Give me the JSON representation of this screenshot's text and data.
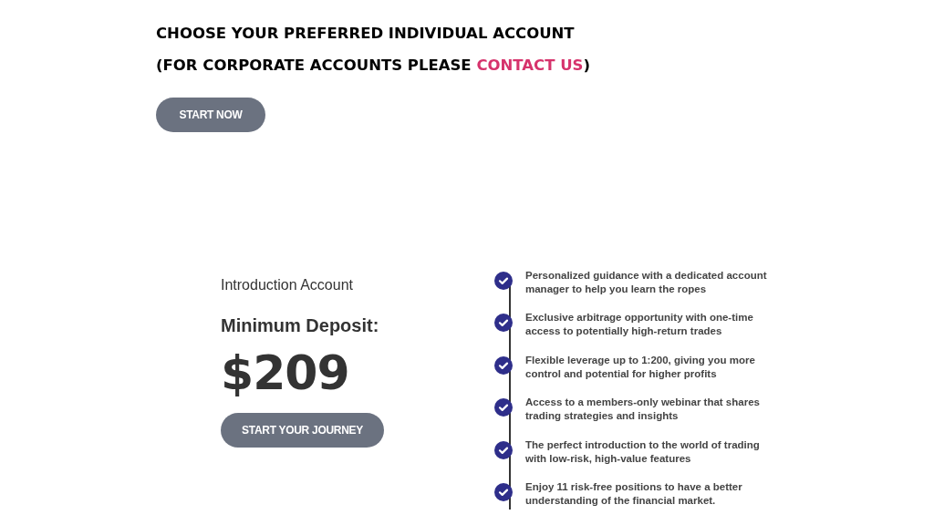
{
  "header": {
    "title": "CHOOSE YOUR PREFERRED INDIVIDUAL ACCOUNT",
    "subtitle": {
      "before": "(FOR CORPORATE ACCOUNTS PLEASE ",
      "link": "CONTACT US",
      "after": ")"
    },
    "button": "START NOW"
  },
  "account": {
    "name": "Introduction Account",
    "deposit_label": "Minimum Deposit:",
    "amount": "$209",
    "button": "START YOUR JOURNEY"
  },
  "features": [
    {
      "text": "Personalized guidance with a dedicated account manager to help you learn the ropes",
      "checked": true
    },
    {
      "text": "Exclusive arbitrage opportunity with one-time access to potentially high-return trades",
      "checked": true
    },
    {
      "text": "Flexible leverage up to 1:200, giving you more control and potential for higher profits",
      "checked": true
    },
    {
      "text": "Access to a members-only webinar that shares trading strategies and insights",
      "checked": true
    },
    {
      "text": "The perfect introduction to the world of trading with low-risk, high-value features",
      "checked": true
    },
    {
      "text": "Enjoy 11 risk-free positions to have a better understanding of the financial market.",
      "checked": true
    }
  ]
}
